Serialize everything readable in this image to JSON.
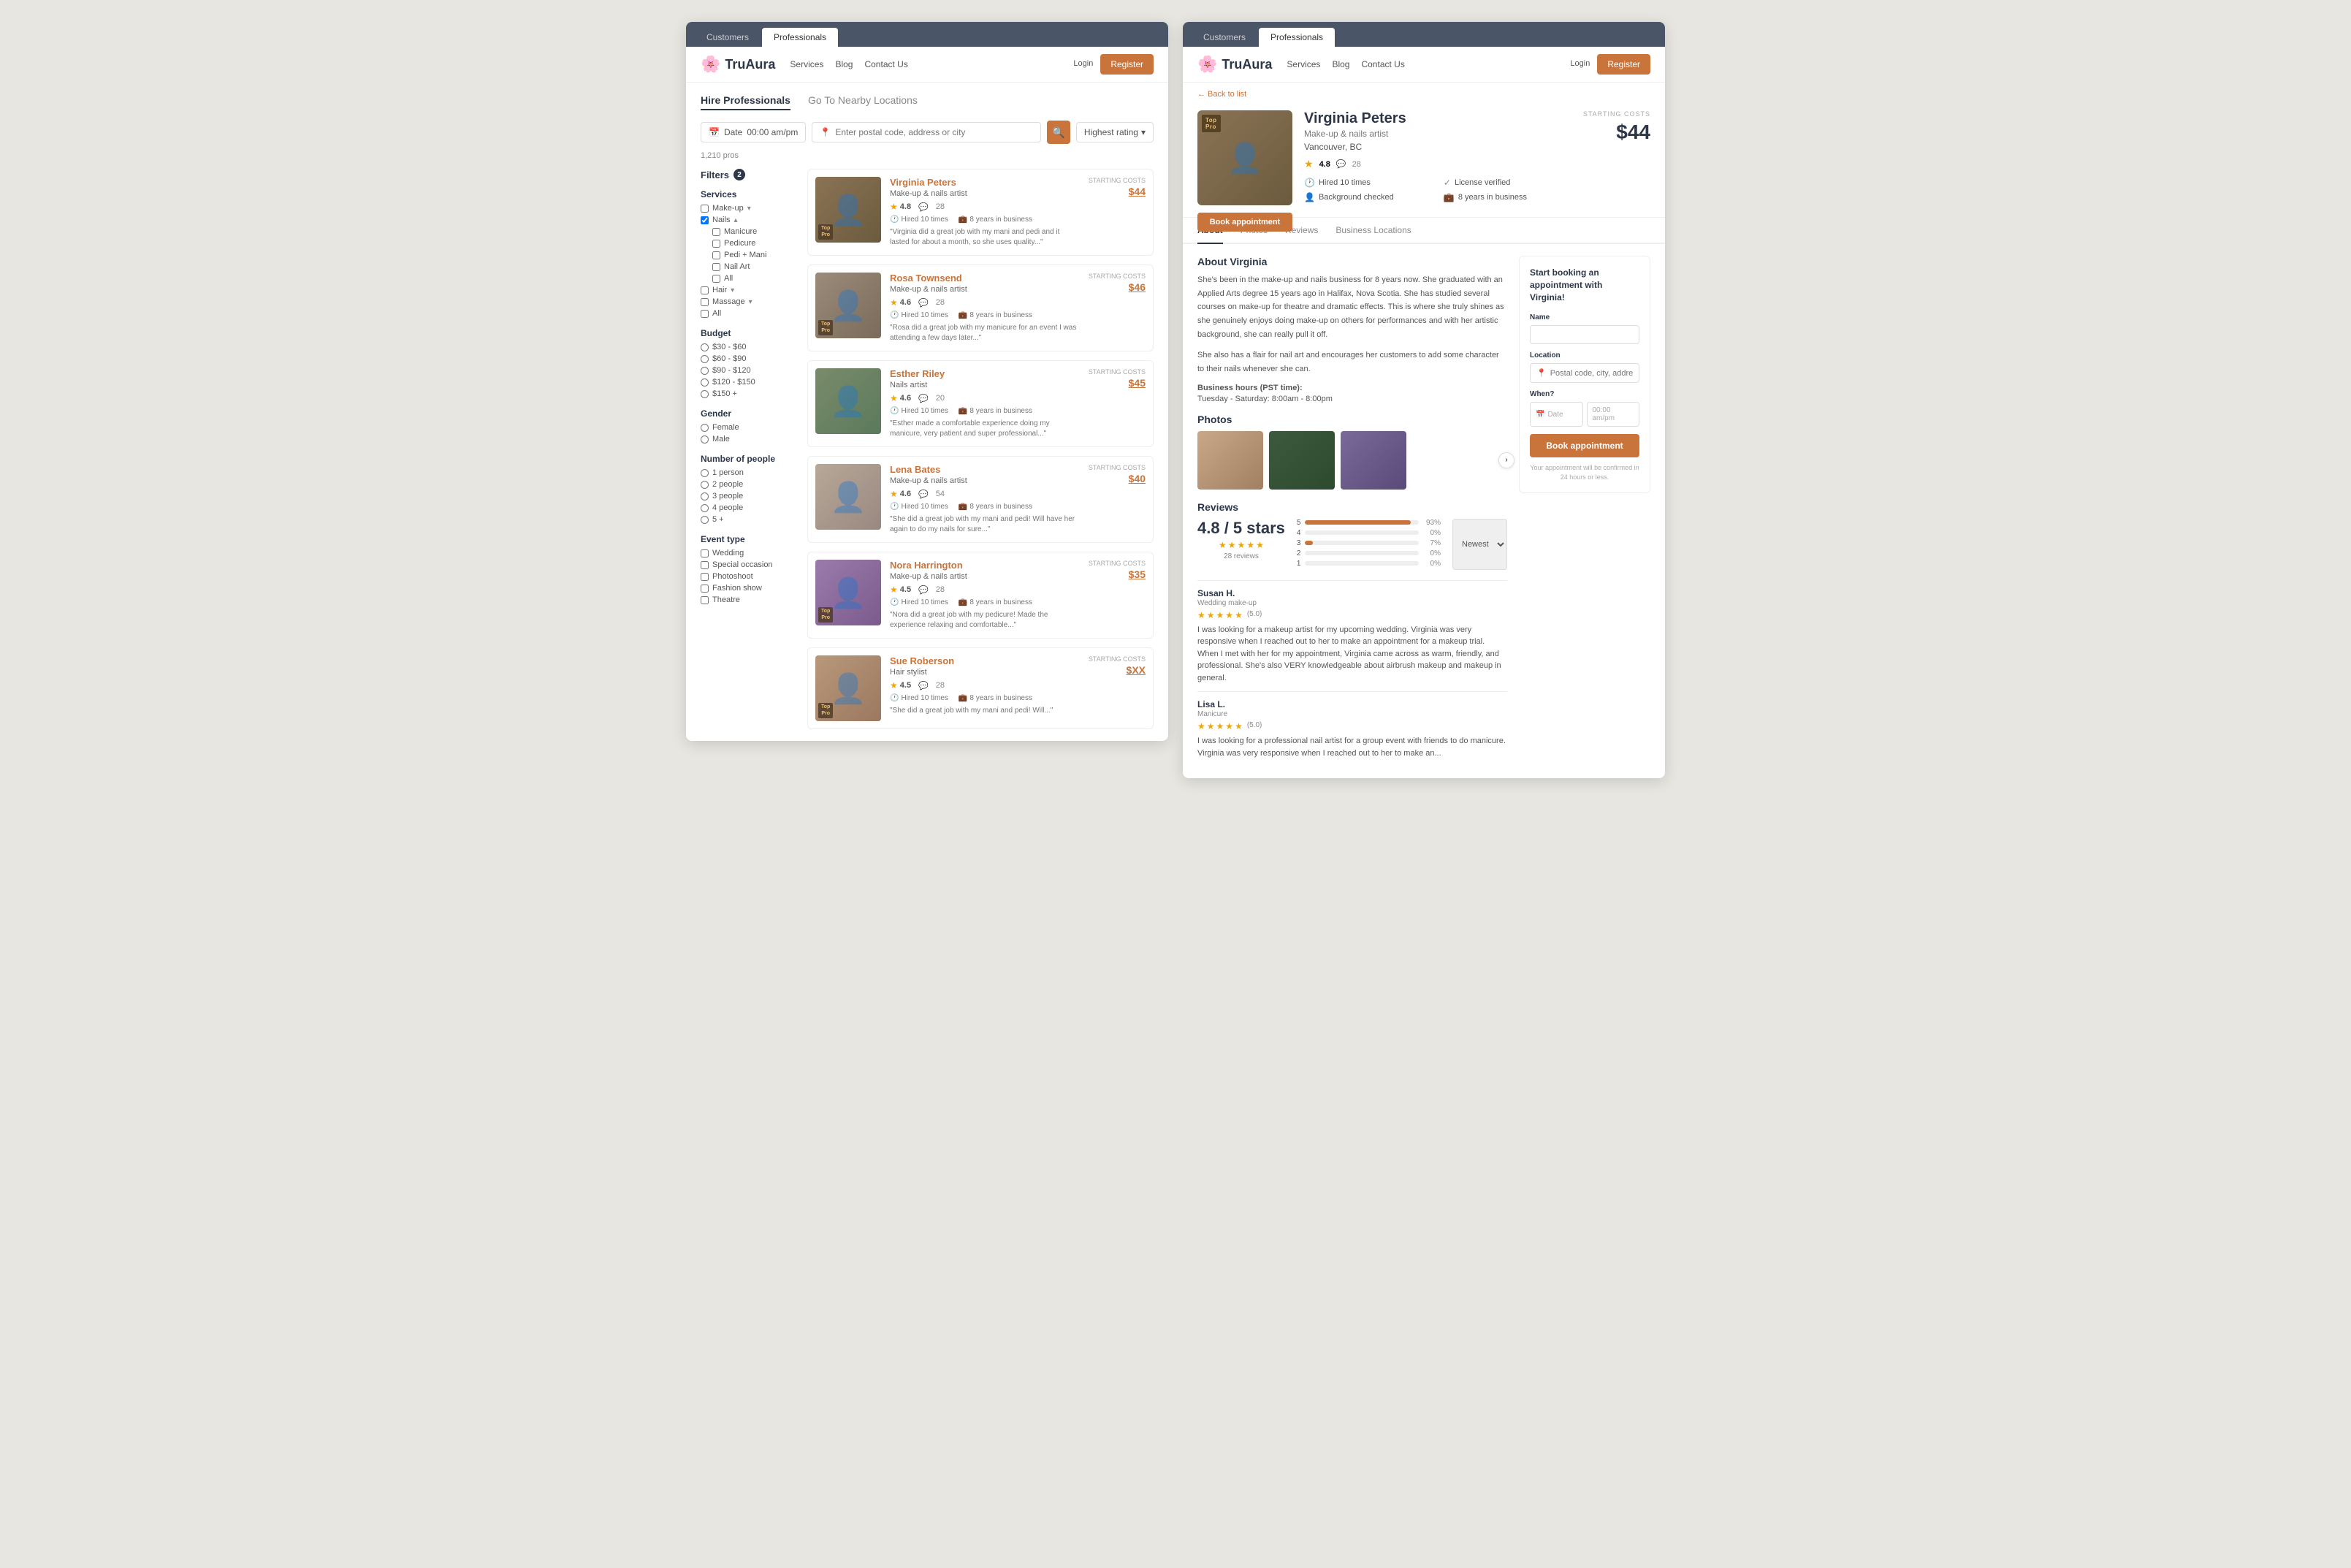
{
  "nav": {
    "logo": "TruAura",
    "links": [
      "Services",
      "Blog",
      "Contact Us"
    ],
    "login": "Login",
    "register": "Register"
  },
  "tabs": {
    "customers": "Customers",
    "professionals": "Professionals"
  },
  "left_panel": {
    "page_tabs": [
      "Hire Professionals",
      "Go To Nearby Locations"
    ],
    "search": {
      "date_placeholder": "Date",
      "time_placeholder": "00:00 am/pm",
      "location_placeholder": "Enter postal code, address or city",
      "sort_default": "Highest rating"
    },
    "results_count": "1,210 pros",
    "filters": {
      "title": "Filters",
      "count": "2",
      "services": {
        "label": "Services",
        "items": [
          "Make-up",
          "Nails",
          "Manicure",
          "Pedicure",
          "Pedi + Mani",
          "Nail Art",
          "All",
          "Hair",
          "Massage",
          "All"
        ]
      },
      "budget": {
        "label": "Budget",
        "items": [
          "$30 - $60",
          "$60 - $90",
          "$90 - $120",
          "$120 - $150",
          "$150 +"
        ]
      },
      "gender": {
        "label": "Gender",
        "items": [
          "Female",
          "Male"
        ]
      },
      "number_of_people": {
        "label": "Number of people",
        "items": [
          "1 person",
          "2 people",
          "3 people",
          "4 people",
          "5 +"
        ]
      },
      "event_type": {
        "label": "Event type",
        "items": [
          "Wedding",
          "Special occasion",
          "Photoshoot",
          "Fashion show",
          "Theatre"
        ]
      }
    },
    "listings": [
      {
        "id": 1,
        "name": "Virginia Peters",
        "title": "Make-up & nails artist",
        "rating": "4.8",
        "reviews": "28",
        "hired": "Hired 10 times",
        "years": "8 years in business",
        "quote": "\"Virginia did a great job with my mani and pedi and it lasted for about a month, so she uses quality...\"",
        "price": "$44",
        "top_pro": true,
        "photo_class": "photo-virginia"
      },
      {
        "id": 2,
        "name": "Rosa Townsend",
        "title": "Make-up & nails artist",
        "rating": "4.6",
        "reviews": "28",
        "hired": "Hired 10 times",
        "years": "8 years in business",
        "quote": "\"Rosa did a great job with my manicure for an event I was attending a few days later...\"",
        "price": "$46",
        "top_pro": true,
        "photo_class": "photo-rosa"
      },
      {
        "id": 3,
        "name": "Esther Riley",
        "title": "Nails artist",
        "rating": "4.6",
        "reviews": "20",
        "hired": "Hired 10 times",
        "years": "8 years in business",
        "quote": "\"Esther made a comfortable experience doing my manicure, very patient and super professional...\"",
        "price": "$45",
        "top_pro": false,
        "photo_class": "photo-esther"
      },
      {
        "id": 4,
        "name": "Lena Bates",
        "title": "Make-up & nails artist",
        "rating": "4.6",
        "reviews": "54",
        "hired": "Hired 10 times",
        "years": "8 years in business",
        "quote": "\"She did a great job with my mani and pedi! Will have her again to do my nails for sure...\"",
        "price": "$40",
        "top_pro": false,
        "photo_class": "photo-lena"
      },
      {
        "id": 5,
        "name": "Nora Harrington",
        "title": "Make-up & nails artist",
        "rating": "4.5",
        "reviews": "28",
        "hired": "Hired 10 times",
        "years": "8 years in business",
        "quote": "\"Nora did a great job with my pedicure! Made the experience relaxing and comfortable...\"",
        "price": "$35",
        "top_pro": true,
        "photo_class": "photo-nora"
      },
      {
        "id": 6,
        "name": "Sue Roberson",
        "title": "Hair stylist",
        "rating": "4.5",
        "reviews": "28",
        "hired": "Hired 10 times",
        "years": "8 years in business",
        "quote": "\"She did a great job with my mani and pedi! Will...\"",
        "price": "$XX",
        "top_pro": true,
        "photo_class": "photo-sue"
      }
    ]
  },
  "right_panel": {
    "back_link": "← Back to list",
    "profile": {
      "name": "Virginia Peters",
      "title": "Make-up & nails artist",
      "location": "Vancouver, BC",
      "rating": "4.8",
      "reviews": "28",
      "hired": "Hired 10 times",
      "license": "License verified",
      "background": "Background checked",
      "years": "8 years in business",
      "starting_costs_label": "STARTING COSTS",
      "starting_cost": "$44",
      "top_pro": true
    },
    "tabs": [
      "About",
      "Photos",
      "Reviews",
      "Business Locations"
    ],
    "about": {
      "heading": "About Virginia",
      "paragraphs": [
        "She's been in the make-up and nails business for 8 years now. She graduated with an Applied Arts degree 15 years ago in Halifax, Nova Scotia. She has studied several courses on make-up for theatre and dramatic effects. This is where she truly shines as she genuinely enjoys doing make-up on others for performances and with her artistic background, she can really pull it off.",
        "She also has a flair for nail art and encourages her customers to add some character to their nails whenever she can."
      ],
      "hours_label": "Business hours (PST time):",
      "hours_value": "Tuesday - Saturday: 8:00am - 8:00pm"
    },
    "photos": {
      "heading": "Photos",
      "items": [
        "photo-thumb-1",
        "photo-thumb-2",
        "photo-thumb-3"
      ]
    },
    "reviews": {
      "heading": "Reviews",
      "score": "4.8 / 5 stars",
      "total": "28 reviews",
      "big_score": "4.8",
      "bars": [
        {
          "label": "5",
          "pct": 93,
          "display": "93%"
        },
        {
          "label": "4",
          "pct": 0,
          "display": "0%"
        },
        {
          "label": "3",
          "pct": 7,
          "display": "7%"
        },
        {
          "label": "2",
          "pct": 0,
          "display": "0%"
        },
        {
          "label": "1",
          "pct": 0,
          "display": "0%"
        }
      ],
      "sort_label": "Newest",
      "items": [
        {
          "name": "Susan H.",
          "service": "Wedding make-up",
          "stars": 5,
          "score_display": "(5.0)",
          "text": "I was looking for a makeup artist for my upcoming wedding. Virginia was very responsive when I reached out to her to make an appointment for a makeup trial. When I met with her for my appointment, Virginia came across as warm, friendly, and professional. She's also VERY knowledgeable about airbrush makeup and makeup in general."
        },
        {
          "name": "Lisa L.",
          "service": "Manicure",
          "stars": 5,
          "score_display": "(5.0)",
          "text": "I was looking for a professional nail artist for a group event with friends to do manicure. Virginia was very responsive when I reached out to her to make an..."
        }
      ]
    },
    "booking": {
      "title": "Start booking an appointment with Virginia!",
      "name_label": "Name",
      "name_placeholder": "",
      "location_label": "Location",
      "location_placeholder": "Postal code, city, address...",
      "when_label": "When?",
      "date_placeholder": "Date",
      "time_placeholder": "00:00 am/pm",
      "book_btn": "Book appointment",
      "note": "Your appointment will be confirmed in 24 hours or less."
    }
  }
}
